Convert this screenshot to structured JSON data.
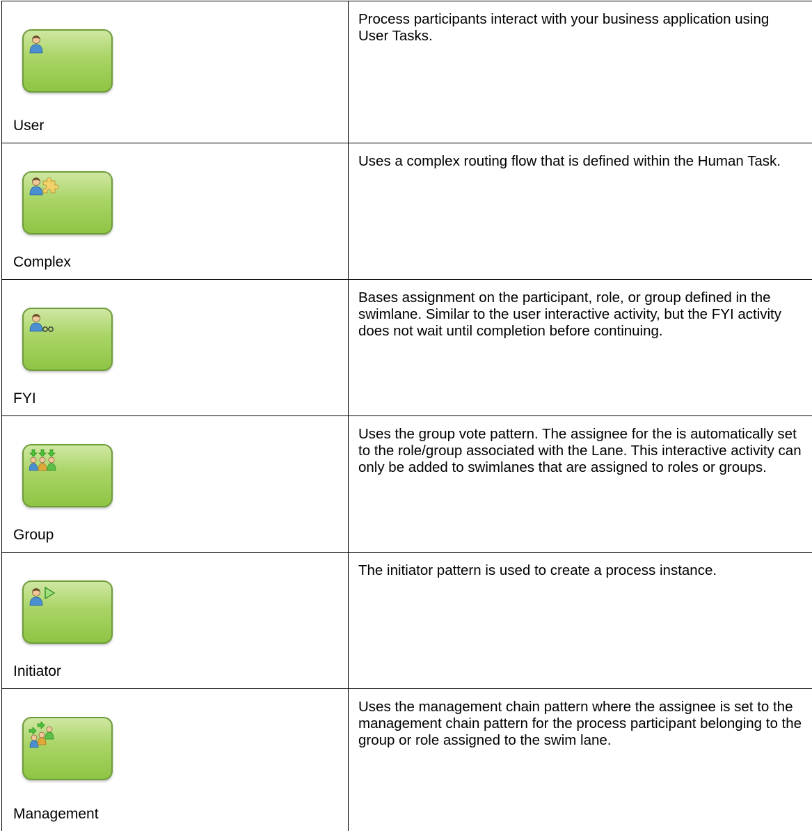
{
  "rows": [
    {
      "label": "User",
      "icon": "user-icon",
      "description": "Process participants interact with your business application using User Tasks."
    },
    {
      "label": "Complex",
      "icon": "complex-icon",
      "description": "Uses a complex routing flow that is defined within the Human Task."
    },
    {
      "label": "FYI",
      "icon": "fyi-icon",
      "description": "Bases assignment on the participant, role, or group defined in the swimlane. Similar to the user interactive activity, but the FYI activity does not wait until completion before continuing."
    },
    {
      "label": "Group",
      "icon": "group-icon",
      "description": "Uses the group vote pattern. The assignee for the is automatically set to the role/group associated with the Lane. This interactive activity can only be added to swimlanes that are assigned to roles or groups."
    },
    {
      "label": "Initiator",
      "icon": "initiator-icon",
      "description": "The initiator pattern is used to create a process instance."
    },
    {
      "label": "Management",
      "icon": "management-icon",
      "description": "Uses the management chain pattern where the assignee is set to the management chain pattern for the process participant belonging to the group or role assigned to the swim lane."
    }
  ],
  "colors": {
    "task_fill": "#a9d465",
    "task_border": "#6e9c3a",
    "person_blue": "#4a8fd0",
    "person_skin": "#f2c79a",
    "arrow_green": "#4cc23a",
    "puzzle_yellow": "#f2d16b"
  }
}
